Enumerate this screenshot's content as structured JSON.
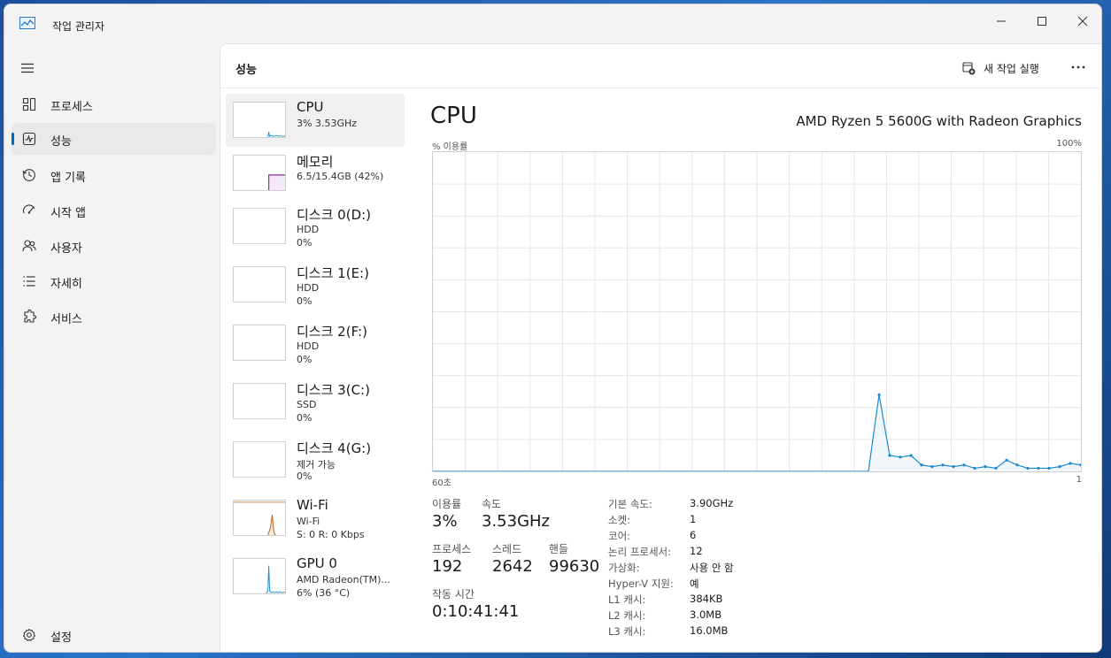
{
  "window": {
    "title": "작업 관리자"
  },
  "nav": {
    "items": [
      {
        "label": "프로세스",
        "icon": "processes-icon"
      },
      {
        "label": "성능",
        "icon": "performance-icon",
        "active": true
      },
      {
        "label": "앱 기록",
        "icon": "history-icon"
      },
      {
        "label": "시작 앱",
        "icon": "startup-icon"
      },
      {
        "label": "사용자",
        "icon": "users-icon"
      },
      {
        "label": "자세히",
        "icon": "details-icon"
      },
      {
        "label": "서비스",
        "icon": "services-icon"
      }
    ],
    "settings_label": "설정"
  },
  "header": {
    "title": "성능",
    "run_task_label": "새 작업 실행"
  },
  "devices": [
    {
      "name": "CPU",
      "lines": [
        "3% 3.53GHz"
      ]
    },
    {
      "name": "메모리",
      "lines": [
        "6.5/15.4GB (42%)"
      ]
    },
    {
      "name": "디스크 0(D:)",
      "lines": [
        "HDD",
        "0%"
      ]
    },
    {
      "name": "디스크 1(E:)",
      "lines": [
        "HDD",
        "0%"
      ]
    },
    {
      "name": "디스크 2(F:)",
      "lines": [
        "HDD",
        "0%"
      ]
    },
    {
      "name": "디스크 3(C:)",
      "lines": [
        "SSD",
        "0%"
      ]
    },
    {
      "name": "디스크 4(G:)",
      "lines": [
        "제거 가능",
        "0%"
      ]
    },
    {
      "name": "Wi-Fi",
      "lines": [
        "Wi-Fi",
        "S: 0 R: 0 Kbps"
      ]
    },
    {
      "name": "GPU 0",
      "lines": [
        "AMD Radeon(TM)...",
        "6% (36 °C)"
      ]
    }
  ],
  "detail": {
    "title": "CPU",
    "model": "AMD Ryzen 5 5600G with Radeon Graphics",
    "y_label": "% 이용률",
    "y_max_label": "100%",
    "x_left_label": "60초",
    "x_right_label": "1",
    "stats": {
      "utilization_label": "이용률",
      "utilization_value": "3%",
      "speed_label": "속도",
      "speed_value": "3.53GHz",
      "processes_label": "프로세스",
      "processes_value": "192",
      "threads_label": "스레드",
      "threads_value": "2642",
      "handles_label": "핸들",
      "handles_value": "99630",
      "uptime_label": "작동 시간",
      "uptime_value": "0:10:41:41"
    },
    "info": [
      {
        "label": "기본 속도:",
        "value": "3.90GHz"
      },
      {
        "label": "소켓:",
        "value": "1"
      },
      {
        "label": "코어:",
        "value": "6"
      },
      {
        "label": "논리 프로세서:",
        "value": "12"
      },
      {
        "label": "가상화:",
        "value": "사용 안 함"
      },
      {
        "label": "Hyper-V 지원:",
        "value": "예"
      },
      {
        "label": "L1 캐시:",
        "value": "384KB"
      },
      {
        "label": "L2 캐시:",
        "value": "3.0MB"
      },
      {
        "label": "L3 캐시:",
        "value": "16.0MB"
      }
    ]
  },
  "chart_data": {
    "type": "area",
    "x": [
      60,
      59,
      58,
      57,
      56,
      55,
      54,
      53,
      52,
      51,
      50,
      49,
      48,
      47,
      46,
      45,
      44,
      43,
      42,
      41,
      40,
      39,
      38,
      37,
      36,
      35,
      34,
      33,
      32,
      31,
      30,
      29,
      28,
      27,
      26,
      25,
      24,
      23,
      22,
      21,
      20,
      19,
      18,
      17,
      16,
      15,
      14,
      13,
      12,
      11,
      10,
      9,
      8,
      7,
      6,
      5,
      4,
      3,
      2,
      1
    ],
    "values": [
      0,
      0,
      0,
      0,
      0,
      0,
      0,
      0,
      0,
      0,
      0,
      0,
      0,
      0,
      0,
      0,
      0,
      0,
      0,
      0,
      0,
      0,
      0,
      0,
      0,
      0,
      0,
      0,
      0,
      0,
      0,
      0,
      0,
      0,
      0,
      0,
      0,
      0,
      0,
      0,
      0,
      0,
      24,
      5,
      4.5,
      5,
      2,
      1.5,
      2,
      1.5,
      2,
      1,
      1.5,
      1,
      3.5,
      2,
      1,
      1,
      1,
      1.5,
      2.5,
      2
    ],
    "ylim": [
      0,
      100
    ],
    "color": "#1a8ad0",
    "fill": "#f1f6fb",
    "grid": true
  },
  "thumbs": {
    "cpu_color": "#1a8ad0",
    "memory_color": "#8b2f9c",
    "wifi_color": "#b06018",
    "gpu_color": "#1a8ad0"
  }
}
